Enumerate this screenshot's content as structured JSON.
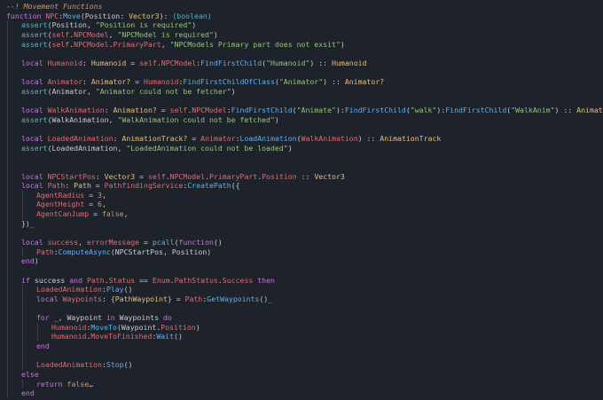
{
  "theme": {
    "background": "#1e222a",
    "keyword": "#c678dd",
    "function": "#61afef",
    "string": "#98c379",
    "number": "#d19a66",
    "type": "#e5c07b",
    "variable": "#e06c75",
    "comment": "#d19a66"
  },
  "code_lines": [
    {
      "indent": 0,
      "tokens": [
        {
          "t": "--! Movement Functions",
          "c": "comment"
        }
      ]
    },
    {
      "indent": 0,
      "tokens": [
        {
          "t": "function ",
          "c": "kw"
        },
        {
          "t": "NPC",
          "c": "var"
        },
        {
          "t": ":",
          "c": "plain"
        },
        {
          "t": "Move",
          "c": "fn"
        },
        {
          "t": "(Position: ",
          "c": "plain"
        },
        {
          "t": "Vector3",
          "c": "ty"
        },
        {
          "t": "): ",
          "c": "plain"
        },
        {
          "t": "(boolean)",
          "c": "op"
        }
      ]
    },
    {
      "indent": 1,
      "tokens": [
        {
          "t": "assert",
          "c": "op"
        },
        {
          "t": "(Position, ",
          "c": "plain"
        },
        {
          "t": "\"Position is required\"",
          "c": "str"
        },
        {
          "t": ")",
          "c": "plain"
        }
      ]
    },
    {
      "indent": 1,
      "tokens": [
        {
          "t": "assert",
          "c": "op"
        },
        {
          "t": "(",
          "c": "plain"
        },
        {
          "t": "self",
          "c": "var"
        },
        {
          "t": ".",
          "c": "plain"
        },
        {
          "t": "NPCModel",
          "c": "var"
        },
        {
          "t": ", ",
          "c": "plain"
        },
        {
          "t": "\"NPCModel is required\"",
          "c": "str"
        },
        {
          "t": ")",
          "c": "plain"
        }
      ]
    },
    {
      "indent": 1,
      "tokens": [
        {
          "t": "assert",
          "c": "op"
        },
        {
          "t": "(",
          "c": "plain"
        },
        {
          "t": "self",
          "c": "var"
        },
        {
          "t": ".",
          "c": "plain"
        },
        {
          "t": "NPCModel",
          "c": "var"
        },
        {
          "t": ".",
          "c": "plain"
        },
        {
          "t": "PrimaryPart",
          "c": "var"
        },
        {
          "t": ", ",
          "c": "plain"
        },
        {
          "t": "\"NPCModels Primary part does not exsit\"",
          "c": "str"
        },
        {
          "t": ")",
          "c": "plain"
        }
      ]
    },
    {
      "indent": 1,
      "tokens": []
    },
    {
      "indent": 1,
      "tokens": [
        {
          "t": "local ",
          "c": "kw"
        },
        {
          "t": "Humanoid",
          "c": "var"
        },
        {
          "t": ": ",
          "c": "plain"
        },
        {
          "t": "Humanoid",
          "c": "ty"
        },
        {
          "t": " = ",
          "c": "plain"
        },
        {
          "t": "self",
          "c": "var"
        },
        {
          "t": ".",
          "c": "plain"
        },
        {
          "t": "NPCModel",
          "c": "var"
        },
        {
          "t": ":",
          "c": "plain"
        },
        {
          "t": "FindFirstChild",
          "c": "fn"
        },
        {
          "t": "(",
          "c": "plain"
        },
        {
          "t": "\"Humanoid\"",
          "c": "str"
        },
        {
          "t": ") :: ",
          "c": "plain"
        },
        {
          "t": "Humanoid",
          "c": "ty"
        }
      ]
    },
    {
      "indent": 1,
      "tokens": []
    },
    {
      "indent": 1,
      "tokens": [
        {
          "t": "local ",
          "c": "kw"
        },
        {
          "t": "Animator",
          "c": "var"
        },
        {
          "t": ": ",
          "c": "plain"
        },
        {
          "t": "Animator?",
          "c": "ty"
        },
        {
          "t": " = ",
          "c": "plain"
        },
        {
          "t": "Humanoid",
          "c": "var"
        },
        {
          "t": ":",
          "c": "plain"
        },
        {
          "t": "FindFirstChildOfClass",
          "c": "fn"
        },
        {
          "t": "(",
          "c": "plain"
        },
        {
          "t": "\"Animator\"",
          "c": "str"
        },
        {
          "t": ") :: ",
          "c": "plain"
        },
        {
          "t": "Animator?",
          "c": "ty"
        }
      ]
    },
    {
      "indent": 1,
      "tokens": [
        {
          "t": "assert",
          "c": "op"
        },
        {
          "t": "(Animator, ",
          "c": "plain"
        },
        {
          "t": "\"Animator could not be fetcher\"",
          "c": "str"
        },
        {
          "t": ")",
          "c": "plain"
        }
      ]
    },
    {
      "indent": 1,
      "tokens": []
    },
    {
      "indent": 1,
      "tokens": [
        {
          "t": "local ",
          "c": "kw"
        },
        {
          "t": "WalkAnimation",
          "c": "var"
        },
        {
          "t": ": ",
          "c": "plain"
        },
        {
          "t": "Animation?",
          "c": "ty"
        },
        {
          "t": " = ",
          "c": "plain"
        },
        {
          "t": "self",
          "c": "var"
        },
        {
          "t": ".",
          "c": "plain"
        },
        {
          "t": "NPCModel",
          "c": "var"
        },
        {
          "t": ":",
          "c": "plain"
        },
        {
          "t": "FindFirstChild",
          "c": "fn"
        },
        {
          "t": "(",
          "c": "plain"
        },
        {
          "t": "\"Animate\"",
          "c": "str"
        },
        {
          "t": "):",
          "c": "plain"
        },
        {
          "t": "FindFirstChild",
          "c": "fn"
        },
        {
          "t": "(",
          "c": "plain"
        },
        {
          "t": "\"walk\"",
          "c": "str"
        },
        {
          "t": "):",
          "c": "plain"
        },
        {
          "t": "FindFirstChild",
          "c": "fn"
        },
        {
          "t": "(",
          "c": "plain"
        },
        {
          "t": "\"WalkAnim\"",
          "c": "str"
        },
        {
          "t": ") :: ",
          "c": "plain"
        },
        {
          "t": "Animation",
          "c": "ty"
        }
      ]
    },
    {
      "indent": 1,
      "tokens": [
        {
          "t": "assert",
          "c": "op"
        },
        {
          "t": "(WalkAnimation, ",
          "c": "plain"
        },
        {
          "t": "\"WalkAnimation could not be fetched\"",
          "c": "str"
        },
        {
          "t": ")",
          "c": "plain"
        }
      ]
    },
    {
      "indent": 1,
      "tokens": []
    },
    {
      "indent": 1,
      "tokens": [
        {
          "t": "local ",
          "c": "kw"
        },
        {
          "t": "LoadedAnimation",
          "c": "var"
        },
        {
          "t": ": ",
          "c": "plain"
        },
        {
          "t": "AnimationTrack?",
          "c": "ty"
        },
        {
          "t": " = ",
          "c": "plain"
        },
        {
          "t": "Animator",
          "c": "var"
        },
        {
          "t": ":",
          "c": "plain"
        },
        {
          "t": "LoadAnimation",
          "c": "fn"
        },
        {
          "t": "(",
          "c": "plain"
        },
        {
          "t": "WalkAnimation",
          "c": "var"
        },
        {
          "t": ") :: ",
          "c": "plain"
        },
        {
          "t": "AnimationTrack",
          "c": "ty"
        }
      ]
    },
    {
      "indent": 1,
      "tokens": [
        {
          "t": "assert",
          "c": "op"
        },
        {
          "t": "(LoadedAnimation, ",
          "c": "plain"
        },
        {
          "t": "\"LoadedAnimation could not be loaded\"",
          "c": "str"
        },
        {
          "t": ")",
          "c": "plain"
        }
      ]
    },
    {
      "indent": 1,
      "tokens": []
    },
    {
      "indent": 1,
      "tokens": []
    },
    {
      "indent": 1,
      "tokens": [
        {
          "t": "local ",
          "c": "kw"
        },
        {
          "t": "NPCStartPos",
          "c": "var"
        },
        {
          "t": ": ",
          "c": "plain"
        },
        {
          "t": "Vector3",
          "c": "ty"
        },
        {
          "t": " = ",
          "c": "plain"
        },
        {
          "t": "self",
          "c": "var"
        },
        {
          "t": ".",
          "c": "plain"
        },
        {
          "t": "NPCModel",
          "c": "var"
        },
        {
          "t": ".",
          "c": "plain"
        },
        {
          "t": "PrimaryPart",
          "c": "var"
        },
        {
          "t": ".",
          "c": "plain"
        },
        {
          "t": "Position",
          "c": "var"
        },
        {
          "t": " :: ",
          "c": "plain"
        },
        {
          "t": "Vector3",
          "c": "ty"
        }
      ]
    },
    {
      "indent": 1,
      "tokens": [
        {
          "t": "local ",
          "c": "kw"
        },
        {
          "t": "Path",
          "c": "var"
        },
        {
          "t": ": ",
          "c": "plain"
        },
        {
          "t": "Path",
          "c": "ty"
        },
        {
          "t": " = ",
          "c": "plain"
        },
        {
          "t": "PathfindingService",
          "c": "var"
        },
        {
          "t": ":",
          "c": "plain"
        },
        {
          "t": "CreatePath",
          "c": "fn"
        },
        {
          "t": "({",
          "c": "plain"
        }
      ]
    },
    {
      "indent": 2,
      "tokens": [
        {
          "t": "AgentRadius",
          "c": "var"
        },
        {
          "t": " = ",
          "c": "plain"
        },
        {
          "t": "3",
          "c": "num"
        },
        {
          "t": ",",
          "c": "plain"
        }
      ]
    },
    {
      "indent": 2,
      "tokens": [
        {
          "t": "AgentHeight",
          "c": "var"
        },
        {
          "t": " = ",
          "c": "plain"
        },
        {
          "t": "6",
          "c": "num"
        },
        {
          "t": ",",
          "c": "plain"
        }
      ]
    },
    {
      "indent": 2,
      "tokens": [
        {
          "t": "AgentCanJump",
          "c": "var"
        },
        {
          "t": " = ",
          "c": "plain"
        },
        {
          "t": "false",
          "c": "num"
        },
        {
          "t": ",",
          "c": "plain"
        }
      ]
    },
    {
      "indent": 1,
      "tokens": [
        {
          "t": "})",
          "c": "plain"
        },
        {
          "t": "_",
          "c": "cursor"
        }
      ]
    },
    {
      "indent": 1,
      "tokens": []
    },
    {
      "indent": 1,
      "tokens": [
        {
          "t": "local ",
          "c": "kw"
        },
        {
          "t": "success",
          "c": "var"
        },
        {
          "t": ", ",
          "c": "plain"
        },
        {
          "t": "errorMessage",
          "c": "var"
        },
        {
          "t": " = ",
          "c": "plain"
        },
        {
          "t": "pcall",
          "c": "op"
        },
        {
          "t": "(",
          "c": "plain"
        },
        {
          "t": "function",
          "c": "kw"
        },
        {
          "t": "()",
          "c": "plain"
        }
      ]
    },
    {
      "indent": 2,
      "tokens": [
        {
          "t": "Path",
          "c": "var"
        },
        {
          "t": ":",
          "c": "plain"
        },
        {
          "t": "ComputeAsync",
          "c": "fn"
        },
        {
          "t": "(NPCStartPos, Position)",
          "c": "plain"
        }
      ]
    },
    {
      "indent": 1,
      "tokens": [
        {
          "t": "end",
          "c": "kw"
        },
        {
          "t": ")",
          "c": "plain"
        }
      ]
    },
    {
      "indent": 1,
      "tokens": []
    },
    {
      "indent": 1,
      "tokens": [
        {
          "t": "if ",
          "c": "kw"
        },
        {
          "t": "success ",
          "c": "plain"
        },
        {
          "t": "and ",
          "c": "kw"
        },
        {
          "t": "Path",
          "c": "var"
        },
        {
          "t": ".",
          "c": "plain"
        },
        {
          "t": "Status",
          "c": "var"
        },
        {
          "t": " == ",
          "c": "plain"
        },
        {
          "t": "Enum",
          "c": "var"
        },
        {
          "t": ".",
          "c": "plain"
        },
        {
          "t": "PathStatus",
          "c": "var"
        },
        {
          "t": ".",
          "c": "plain"
        },
        {
          "t": "Success",
          "c": "var"
        },
        {
          "t": " then",
          "c": "kw"
        }
      ]
    },
    {
      "indent": 2,
      "tokens": [
        {
          "t": "LoadedAnimation",
          "c": "var"
        },
        {
          "t": ":",
          "c": "plain"
        },
        {
          "t": "Play",
          "c": "fn"
        },
        {
          "t": "()",
          "c": "plain"
        }
      ]
    },
    {
      "indent": 2,
      "tokens": [
        {
          "t": "local ",
          "c": "kw"
        },
        {
          "t": "Waypoints",
          "c": "var"
        },
        {
          "t": ": ",
          "c": "plain"
        },
        {
          "t": "{PathWaypoint}",
          "c": "ty"
        },
        {
          "t": " = ",
          "c": "plain"
        },
        {
          "t": "Path",
          "c": "var"
        },
        {
          "t": ":",
          "c": "plain"
        },
        {
          "t": "GetWaypoints",
          "c": "fn"
        },
        {
          "t": "()",
          "c": "plain"
        },
        {
          "t": "_",
          "c": "cursor"
        }
      ]
    },
    {
      "indent": 2,
      "tokens": []
    },
    {
      "indent": 2,
      "tokens": [
        {
          "t": "for ",
          "c": "kw"
        },
        {
          "t": "_, Waypoint ",
          "c": "plain"
        },
        {
          "t": "in ",
          "c": "kw"
        },
        {
          "t": "Waypoints ",
          "c": "plain"
        },
        {
          "t": "do",
          "c": "kw"
        }
      ]
    },
    {
      "indent": 3,
      "tokens": [
        {
          "t": "Humanoid",
          "c": "var"
        },
        {
          "t": ":",
          "c": "plain"
        },
        {
          "t": "MoveTo",
          "c": "fn"
        },
        {
          "t": "(Waypoint.",
          "c": "plain"
        },
        {
          "t": "Position",
          "c": "var"
        },
        {
          "t": ")",
          "c": "plain"
        }
      ]
    },
    {
      "indent": 3,
      "tokens": [
        {
          "t": "Humanoid",
          "c": "var"
        },
        {
          "t": ".",
          "c": "plain"
        },
        {
          "t": "MoveToFinished",
          "c": "var"
        },
        {
          "t": ":",
          "c": "plain"
        },
        {
          "t": "Wait",
          "c": "fn"
        },
        {
          "t": "()",
          "c": "plain"
        }
      ]
    },
    {
      "indent": 2,
      "tokens": [
        {
          "t": "end",
          "c": "kw"
        }
      ]
    },
    {
      "indent": 2,
      "tokens": []
    },
    {
      "indent": 2,
      "tokens": [
        {
          "t": "LoadedAnimation",
          "c": "var"
        },
        {
          "t": ":",
          "c": "plain"
        },
        {
          "t": "Stop",
          "c": "fn"
        },
        {
          "t": "()",
          "c": "plain"
        }
      ]
    },
    {
      "indent": 1,
      "tokens": [
        {
          "t": "else",
          "c": "kw"
        }
      ]
    },
    {
      "indent": 2,
      "tokens": [
        {
          "t": "return ",
          "c": "kw"
        },
        {
          "t": "false",
          "c": "num"
        },
        {
          "t": "…",
          "c": "plain"
        }
      ]
    },
    {
      "indent": 1,
      "tokens": [
        {
          "t": "end",
          "c": "kw"
        }
      ]
    }
  ]
}
